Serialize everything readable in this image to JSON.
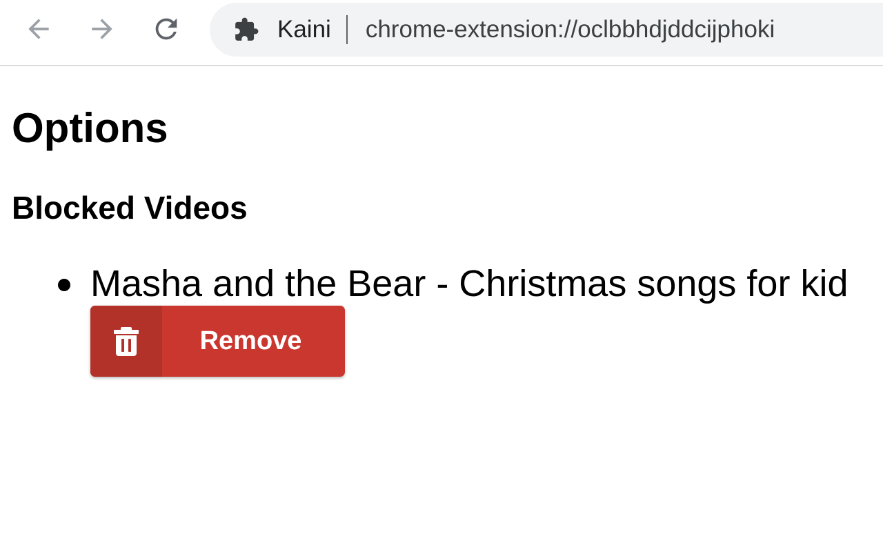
{
  "browser": {
    "extension_name": "Kaini",
    "url": "chrome-extension://oclbbhdjddcijphoki",
    "icons": {
      "back": "arrow-left-icon",
      "forward": "arrow-right-icon",
      "reload": "reload-icon",
      "site_info": "puzzle-piece-icon"
    }
  },
  "page": {
    "title": "Options",
    "section_title": "Blocked Videos",
    "blocked_videos": [
      {
        "title": "Masha and the Bear - Christmas songs for kid",
        "remove_label": "Remove",
        "remove_icon": "trash-icon"
      }
    ]
  },
  "colors": {
    "remove_button": "#c9372f",
    "remove_icon_bg": "#b2322a",
    "nav_icon_disabled": "#9aa0a6",
    "nav_icon_active": "#5f6368"
  }
}
